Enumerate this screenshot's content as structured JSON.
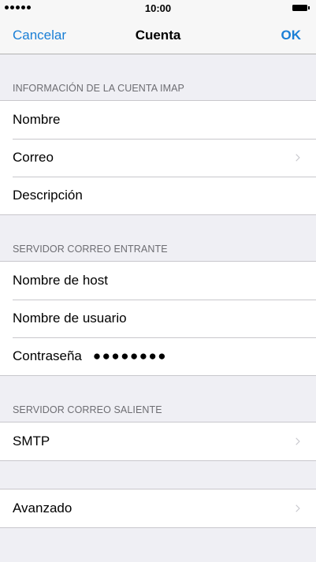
{
  "status_bar": {
    "time": "10:00",
    "signal_icon": "signal-dots-icon",
    "battery_icon": "battery-icon"
  },
  "nav": {
    "left_label": "Cancelar",
    "title": "Cuenta",
    "right_label": "OK",
    "accent_color": "#1a7fd6"
  },
  "sections": {
    "imap": {
      "header": "INFORMACIÓN DE LA CUENTA IMAP",
      "name_label": "Nombre",
      "email_label": "Correo",
      "description_label": "Descripción"
    },
    "incoming": {
      "header": "SERVIDOR CORREO ENTRANTE",
      "host_label": "Nombre de host",
      "user_label": "Nombre de usuario",
      "password_label": "Contraseña",
      "password_value": "●●●●●●●●"
    },
    "outgoing": {
      "header": "SERVIDOR CORREO SALIENTE",
      "smtp_label": "SMTP"
    },
    "advanced": {
      "advanced_label": "Avanzado"
    }
  }
}
